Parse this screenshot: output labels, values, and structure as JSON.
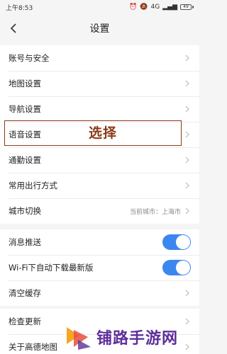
{
  "status_bar": {
    "time": "上午8:53",
    "battery": "49",
    "signal_text": "4G"
  },
  "header": {
    "title": "设置"
  },
  "group1": {
    "items": [
      {
        "label": "账号与安全"
      },
      {
        "label": "地图设置"
      },
      {
        "label": "导航设置"
      },
      {
        "label": "语音设置"
      },
      {
        "label": "通勤设置"
      },
      {
        "label": "常用出行方式"
      },
      {
        "label": "城市切换",
        "value": "当前城市：上海市"
      }
    ]
  },
  "group2": {
    "items": [
      {
        "label": "消息推送",
        "toggle": true
      },
      {
        "label": "Wi-Fi下自动下载最新版",
        "toggle": true
      },
      {
        "label": "清空缓存"
      }
    ]
  },
  "group3": {
    "items": [
      {
        "label": "检查更新"
      },
      {
        "label": "关于高德地图"
      }
    ]
  },
  "annotation": {
    "text": "选择",
    "color": "#8a3b1a"
  },
  "watermark": {
    "text": "铺路手游网"
  },
  "colors": {
    "toggle_on": "#3c86f0",
    "background": "#f5f5f5",
    "watermark": "#5d2f9a"
  }
}
